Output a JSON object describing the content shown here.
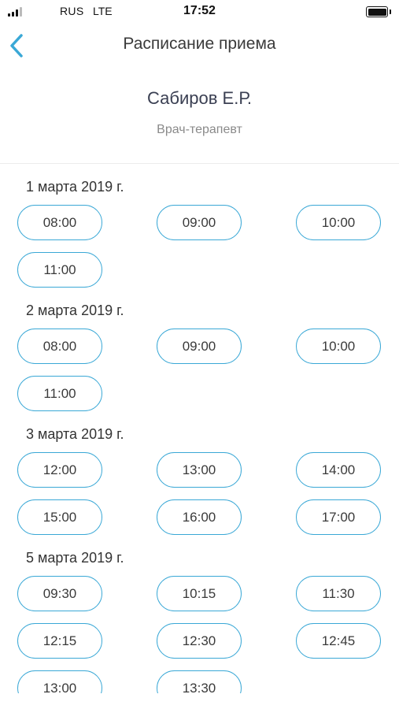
{
  "status_bar": {
    "carrier": "RUS",
    "network": "LTE",
    "time": "17:52",
    "signal_bars_active": 3,
    "battery_level": 1.0
  },
  "nav": {
    "title": "Расписание приема",
    "back_icon": "chevron-left-icon"
  },
  "doctor": {
    "name": "Сабиров Е.Р.",
    "specialty": "Врач-терапевт"
  },
  "colors": {
    "accent": "#3aa8d6",
    "text": "#3a3a3a",
    "secondary_text": "#8a8a8a"
  },
  "schedule": [
    {
      "date": "1 марта 2019 г.",
      "slots": [
        "08:00",
        "09:00",
        "10:00",
        "11:00"
      ]
    },
    {
      "date": "2 марта 2019 г.",
      "slots": [
        "08:00",
        "09:00",
        "10:00",
        "11:00"
      ]
    },
    {
      "date": "3 марта 2019 г.",
      "slots": [
        "12:00",
        "13:00",
        "14:00",
        "15:00",
        "16:00",
        "17:00"
      ]
    },
    {
      "date": "5 марта 2019 г.",
      "slots": [
        "09:30",
        "10:15",
        "11:30",
        "12:15",
        "12:30",
        "12:45",
        "13:00",
        "13:30"
      ]
    }
  ]
}
